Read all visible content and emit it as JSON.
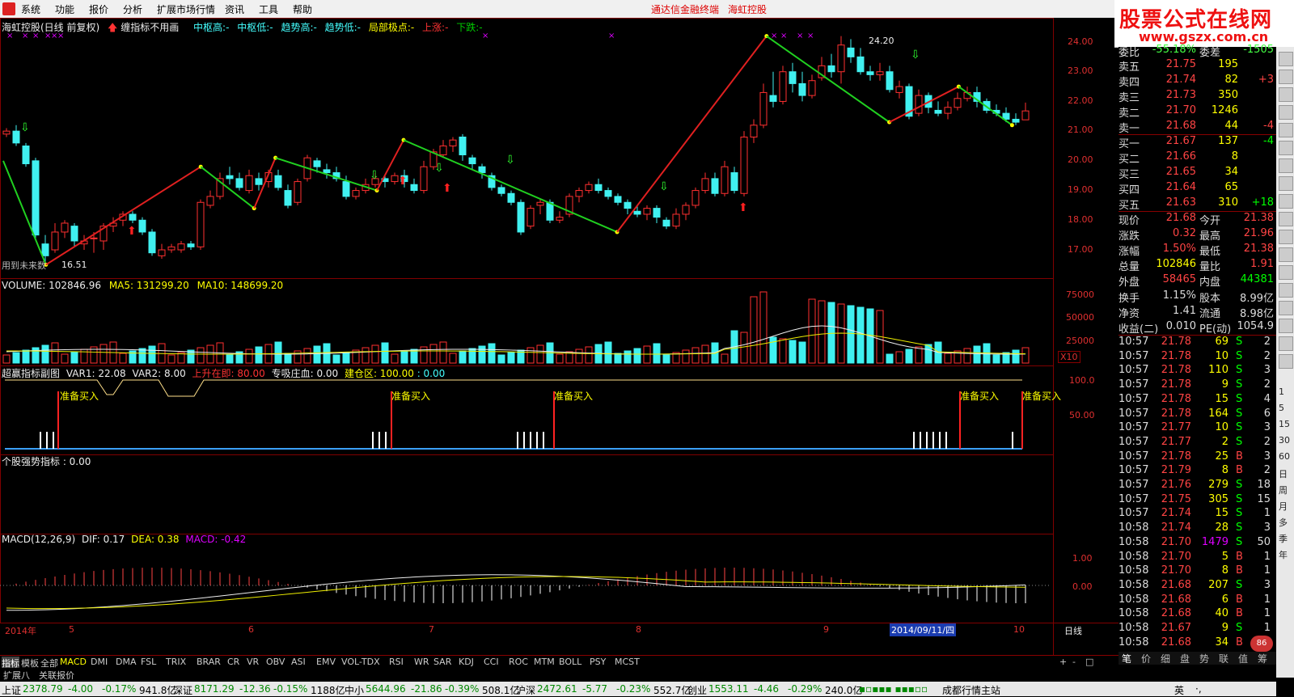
{
  "menu": {
    "items": [
      "系统",
      "功能",
      "报价",
      "分析",
      "扩展市场行情",
      "资讯",
      "工具",
      "帮助"
    ],
    "promo1": "通达信金融终端",
    "promo2": "海虹控股"
  },
  "brand": {
    "line1": "股票公式在线网",
    "line2": "www.gszx.com.cn"
  },
  "price_panel": {
    "title": "海虹控股(日线 前复权)",
    "note": "缠指标不用画",
    "labels": [
      "中枢高:-",
      "中枢低:-",
      "趋势高:-",
      "趋势低:-",
      "局部极点:-",
      "上涨:-",
      "下跌:-"
    ],
    "high_label": "24.20",
    "low_label": "16.51",
    "footer_note": "用到未来数",
    "y_ticks": [
      "24.00",
      "23.00",
      "22.00",
      "21.00",
      "20.00",
      "19.00",
      "18.00",
      "17.00"
    ]
  },
  "volume_panel": {
    "legend": "VOLUME: 102846.96",
    "ma5": "MA5: 131299.20",
    "ma10": "MA10: 148699.20",
    "y_ticks": [
      "75000",
      "50000",
      "25000"
    ],
    "unit": "X10"
  },
  "indicator_panel": {
    "title": "超赢指标副图",
    "var1": "VAR1: 22.08",
    "var2": "VAR2: 8.00",
    "rise": "上升在即: 80.00",
    "absorb": "专吸庄血: 0.00",
    "build": "建仓区: 100.00",
    "tail": ": 0.00",
    "y_ticks": [
      "100.0",
      "50.00"
    ],
    "signal_label": "准备买入"
  },
  "strength_panel": {
    "title": "个股强势指标 : 0.00"
  },
  "macd_panel": {
    "title": "MACD(12,26,9)",
    "dif": "DIF: 0.17",
    "dea": "DEA: 0.38",
    "macd": "MACD: -0.42",
    "y_ticks": [
      "1.00",
      "0.00"
    ]
  },
  "x_axis": {
    "labels": [
      "2014年",
      "5",
      "6",
      "7",
      "8",
      "9",
      "10"
    ],
    "cursor": "2014/09/11/四",
    "period": "日线"
  },
  "quote": {
    "webi": {
      "label": "委比",
      "val": "-55.18%",
      "label2": "委差",
      "val2": "-1505"
    },
    "asks": [
      {
        "label": "卖五",
        "price": "21.75",
        "vol": "195",
        "chg": ""
      },
      {
        "label": "卖四",
        "price": "21.74",
        "vol": "82",
        "chg": "+3"
      },
      {
        "label": "卖三",
        "price": "21.73",
        "vol": "350",
        "chg": ""
      },
      {
        "label": "卖二",
        "price": "21.70",
        "vol": "1246",
        "chg": ""
      },
      {
        "label": "卖一",
        "price": "21.68",
        "vol": "44",
        "chg": "-4"
      }
    ],
    "bids": [
      {
        "label": "买一",
        "price": "21.67",
        "vol": "137",
        "chg": "-4"
      },
      {
        "label": "买二",
        "price": "21.66",
        "vol": "8",
        "chg": ""
      },
      {
        "label": "买三",
        "price": "21.65",
        "vol": "34",
        "chg": ""
      },
      {
        "label": "买四",
        "price": "21.64",
        "vol": "65",
        "chg": ""
      },
      {
        "label": "买五",
        "price": "21.63",
        "vol": "310",
        "chg": "+18"
      }
    ],
    "stats": [
      {
        "l1": "现价",
        "v1": "21.68",
        "l2": "今开",
        "v2": "21.38"
      },
      {
        "l1": "涨跌",
        "v1": "0.32",
        "l2": "最高",
        "v2": "21.96"
      },
      {
        "l1": "涨幅",
        "v1": "1.50%",
        "l2": "最低",
        "v2": "21.38"
      },
      {
        "l1": "总量",
        "v1": "102846",
        "l2": "量比",
        "v2": "1.91"
      },
      {
        "l1": "外盘",
        "v1": "58465",
        "l2": "内盘",
        "v2": "44381"
      },
      {
        "l1": "换手",
        "v1": "1.15%",
        "l2": "股本",
        "v2": "8.99亿"
      },
      {
        "l1": "净资",
        "v1": "1.41",
        "l2": "流通",
        "v2": "8.98亿"
      },
      {
        "l1": "收益(二)",
        "v1": "0.010",
        "l2": "PE(动)",
        "v2": "1054.9"
      }
    ],
    "ticks": [
      {
        "t": "10:57",
        "p": "21.78",
        "v": "69",
        "s": "S",
        "n": "2"
      },
      {
        "t": "10:57",
        "p": "21.78",
        "v": "10",
        "s": "S",
        "n": "2"
      },
      {
        "t": "10:57",
        "p": "21.78",
        "v": "110",
        "s": "S",
        "n": "3"
      },
      {
        "t": "10:57",
        "p": "21.78",
        "v": "9",
        "s": "S",
        "n": "2"
      },
      {
        "t": "10:57",
        "p": "21.78",
        "v": "15",
        "s": "S",
        "n": "4"
      },
      {
        "t": "10:57",
        "p": "21.78",
        "v": "164",
        "s": "S",
        "n": "6"
      },
      {
        "t": "10:57",
        "p": "21.77",
        "v": "10",
        "s": "S",
        "n": "3"
      },
      {
        "t": "10:57",
        "p": "21.77",
        "v": "2",
        "s": "S",
        "n": "2"
      },
      {
        "t": "10:57",
        "p": "21.78",
        "v": "25",
        "s": "B",
        "n": "3"
      },
      {
        "t": "10:57",
        "p": "21.79",
        "v": "8",
        "s": "B",
        "n": "2"
      },
      {
        "t": "10:57",
        "p": "21.76",
        "v": "279",
        "s": "S",
        "n": "18"
      },
      {
        "t": "10:57",
        "p": "21.75",
        "v": "305",
        "s": "S",
        "n": "15"
      },
      {
        "t": "10:57",
        "p": "21.74",
        "v": "15",
        "s": "S",
        "n": "1"
      },
      {
        "t": "10:58",
        "p": "21.74",
        "v": "28",
        "s": "S",
        "n": "3"
      },
      {
        "t": "10:58",
        "p": "21.70",
        "v": "1479",
        "s": "S",
        "n": "50"
      },
      {
        "t": "10:58",
        "p": "21.70",
        "v": "5",
        "s": "B",
        "n": "1"
      },
      {
        "t": "10:58",
        "p": "21.70",
        "v": "8",
        "s": "B",
        "n": "1"
      },
      {
        "t": "10:58",
        "p": "21.68",
        "v": "207",
        "s": "S",
        "n": "3"
      },
      {
        "t": "10:58",
        "p": "21.68",
        "v": "6",
        "s": "B",
        "n": "1"
      },
      {
        "t": "10:58",
        "p": "21.68",
        "v": "40",
        "s": "B",
        "n": "1"
      },
      {
        "t": "10:58",
        "p": "21.67",
        "v": "9",
        "s": "S",
        "n": "1"
      },
      {
        "t": "10:58",
        "p": "21.68",
        "v": "34",
        "s": "B",
        "n": "2"
      }
    ],
    "bottom_tabs": [
      "笔",
      "价",
      "细",
      "盘",
      "势",
      "联",
      "值",
      "筹"
    ]
  },
  "indicator_tabs": [
    "指标",
    "模板",
    "全部",
    "MACD",
    "DMI",
    "DMA",
    "FSL",
    "TRIX",
    "BRAR",
    "CR",
    "VR",
    "OBV",
    "ASI",
    "EMV",
    "VOL-TDX",
    "RSI",
    "WR",
    "SAR",
    "KDJ",
    "CCI",
    "ROC",
    "MTM",
    "BOLL",
    "PSY",
    "MCST"
  ],
  "tab_controls": [
    "+",
    "-",
    "□"
  ],
  "sub_tabs": [
    "扩展八",
    "关联报价"
  ],
  "status_bar": [
    {
      "name": "上证",
      "val": "2378.79",
      "chg": "-4.00",
      "pct": "-0.17%",
      "amt": "941.8亿"
    },
    {
      "name": "深证",
      "val": "8171.29",
      "chg": "-12.36",
      "pct": "-0.15%",
      "amt": "1188亿"
    },
    {
      "name": "中小",
      "val": "5644.96",
      "chg": "-21.86",
      "pct": "-0.39%",
      "amt": "508.1亿"
    },
    {
      "name": "沪深",
      "val": "2472.61",
      "chg": "-5.77",
      "pct": "-0.23%",
      "amt": "552.7亿"
    },
    {
      "name": "创业",
      "val": "1553.11",
      "chg": "-4.46",
      "pct": "-0.29%",
      "amt": "240.0亿"
    }
  ],
  "status_site": "成都行情主站",
  "ime": {
    "a": "英",
    "b": "·,"
  },
  "colors": {
    "up": "#ff3030",
    "down": "#40f0f0",
    "rise_line": "#e02020",
    "fall_line": "#20d020",
    "bg": "#000000",
    "grid": "#800000"
  }
}
